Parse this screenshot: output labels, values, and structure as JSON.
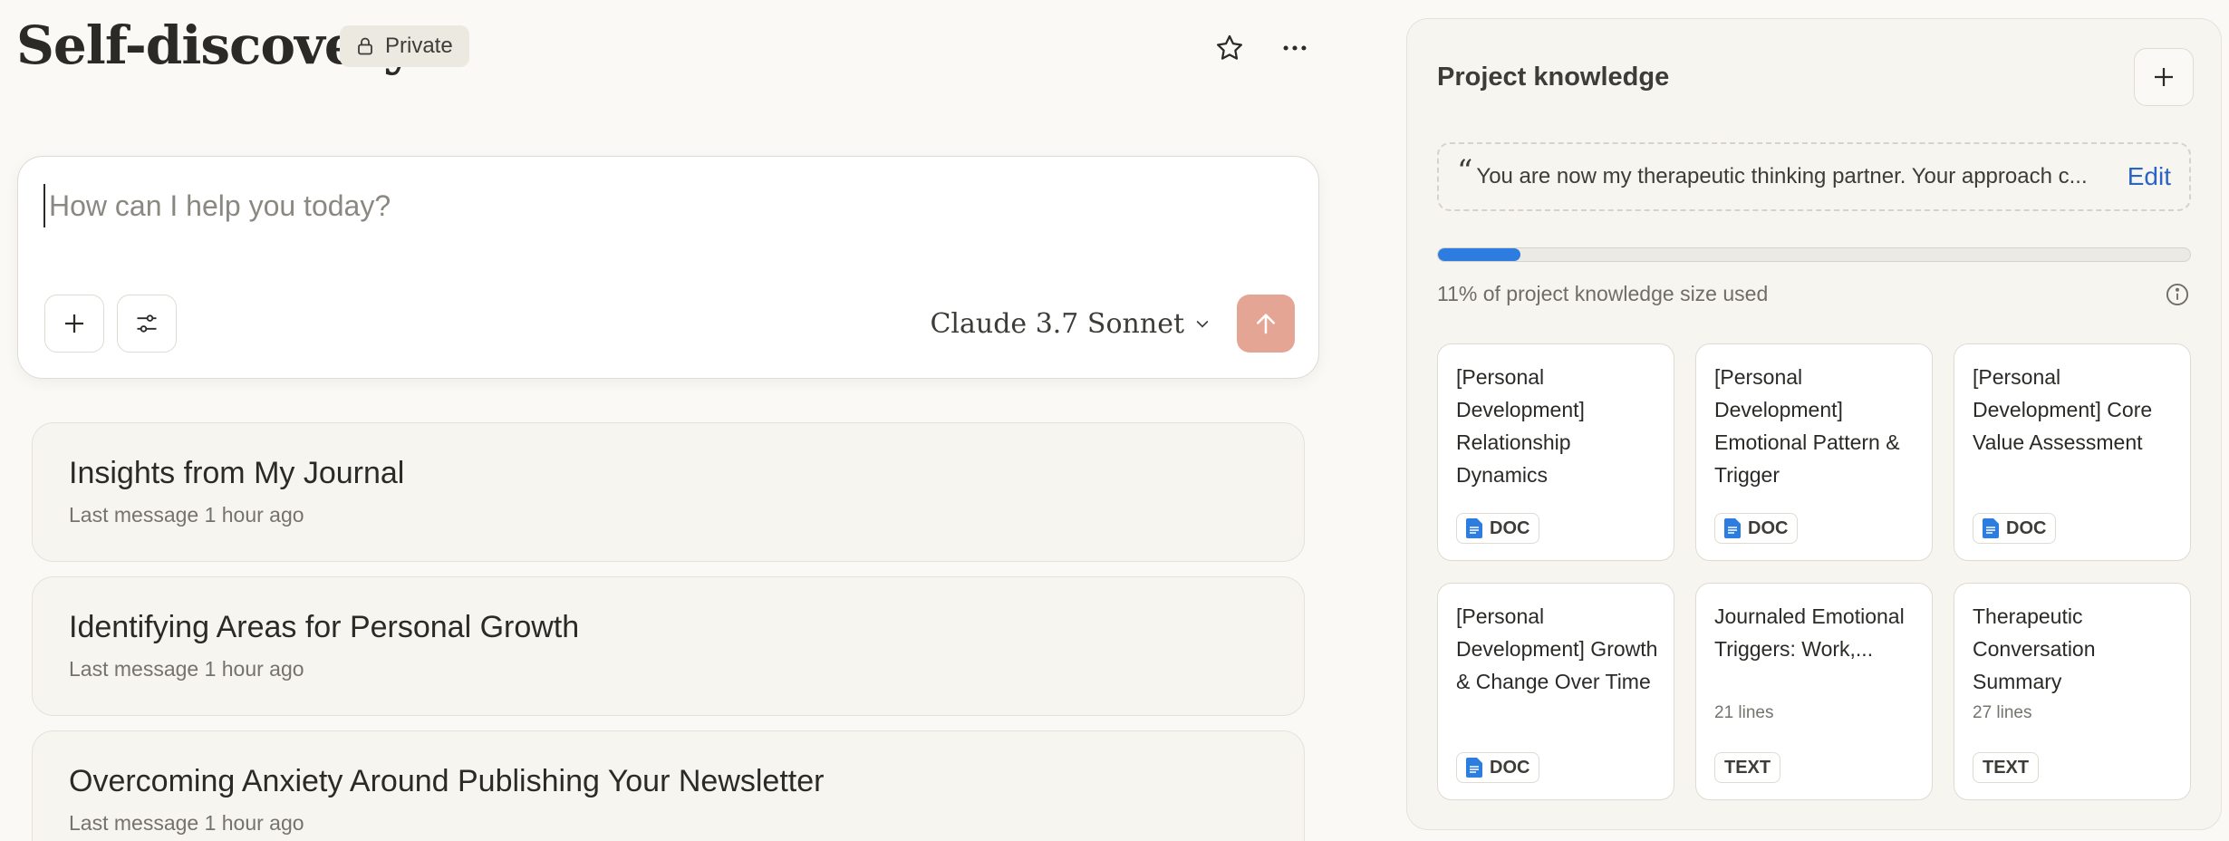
{
  "header": {
    "title": "Self-discovery",
    "visibility": "Private"
  },
  "composer": {
    "placeholder": "How can I help you today?",
    "model": "Claude 3.7 Sonnet"
  },
  "chats": [
    {
      "title": "Insights from My Journal",
      "meta": "Last message 1 hour ago"
    },
    {
      "title": "Identifying Areas for Personal Growth",
      "meta": "Last message 1 hour ago"
    },
    {
      "title": "Overcoming Anxiety Around Publishing Your Newsletter",
      "meta": "Last message 1 hour ago"
    }
  ],
  "knowledge": {
    "title": "Project knowledge",
    "instructions": "You are now my therapeutic thinking partner. Your approach c...",
    "quote_mark": "“",
    "edit_label": "Edit",
    "usage_fraction": 0.11,
    "usage_text": "11% of project knowledge size used",
    "files": [
      {
        "name": "[Personal Development] Relationship Dynamics",
        "lines": "",
        "type": "DOC"
      },
      {
        "name": "[Personal Development] Emotional Pattern & Trigger",
        "lines": "",
        "type": "DOC"
      },
      {
        "name": "[Personal Development] Core Value Assessment",
        "lines": "",
        "type": "DOC"
      },
      {
        "name": "[Personal Development] Growth & Change Over Time",
        "lines": "",
        "type": "DOC"
      },
      {
        "name": "Journaled Emotional Triggers: Work,...",
        "lines": "21 lines",
        "type": "TEXT"
      },
      {
        "name": "Therapeutic Conversation Summary",
        "lines": "27 lines",
        "type": "TEXT"
      }
    ]
  },
  "colors": {
    "background": "#faf9f5",
    "send_button": "#e4a594",
    "usage_fill": "#2d7de0",
    "link": "#2a64c4",
    "doc_icon": "#2d7de0"
  },
  "icons": {
    "visibility": "lock-icon",
    "favorite": "star-icon",
    "more": "ellipsis-icon",
    "add": "plus-icon",
    "tools": "sliders-icon",
    "model_dropdown": "chevron-down-icon",
    "send": "arrow-up-icon",
    "info": "info-icon",
    "doc": "document-icon"
  }
}
